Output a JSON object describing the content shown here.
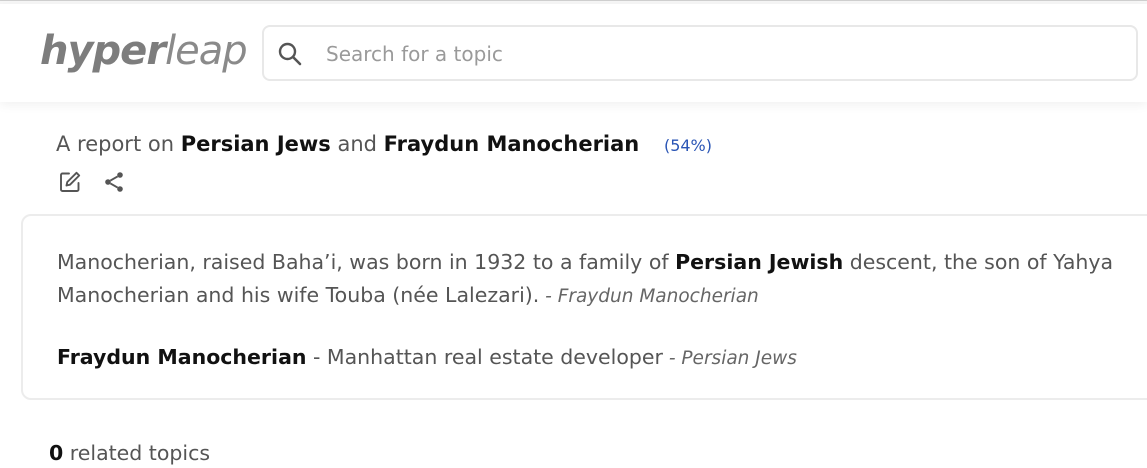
{
  "header": {
    "logo_bold": "hyper",
    "logo_light": "leap",
    "search_placeholder": "Search for a topic",
    "search_value": ""
  },
  "report": {
    "prefix": "A report on",
    "topic_a": "Persian Jews",
    "conjunction": "and",
    "topic_b": "Fraydun Manocherian",
    "percent": "(54%)",
    "icons": [
      "edit-icon",
      "share-icon"
    ]
  },
  "card": {
    "p1_part1": "Manocherian, raised Baha’i, was born in 1932 to a family of ",
    "p1_bold": "Persian Jewish",
    "p1_part2": " descent, the son of Yahya Manocherian and his wife Touba (née Lalezari).",
    "p1_source": " - Fraydun Manocherian",
    "p2_bold": "Fraydun Manocherian",
    "p2_text": " - Manhattan real estate developer",
    "p2_source": " - Persian Jews"
  },
  "related": {
    "count": "0",
    "label": " related topics"
  },
  "colors": {
    "accent_blue": "#2a55b5",
    "text": "#555555",
    "strong_text": "#111111"
  }
}
